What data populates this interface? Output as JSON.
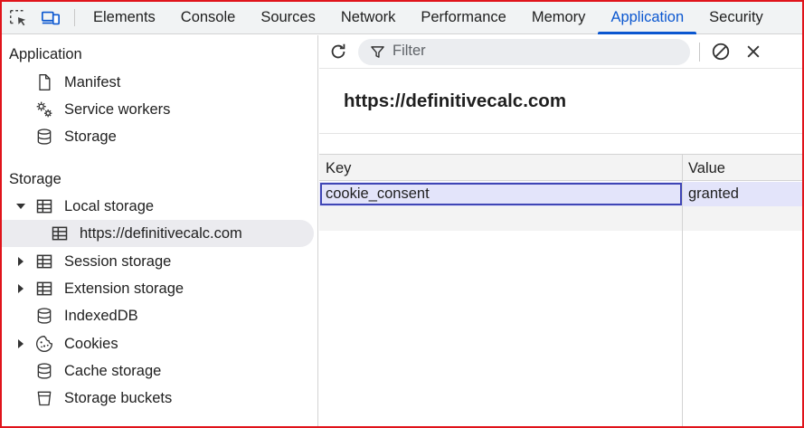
{
  "tabs": [
    {
      "label": "Elements"
    },
    {
      "label": "Console"
    },
    {
      "label": "Sources"
    },
    {
      "label": "Network"
    },
    {
      "label": "Performance"
    },
    {
      "label": "Memory"
    },
    {
      "label": "Application",
      "active": true
    },
    {
      "label": "Security"
    }
  ],
  "sidebar": {
    "application_title": "Application",
    "application_items": [
      {
        "label": "Manifest",
        "icon": "file-icon"
      },
      {
        "label": "Service workers",
        "icon": "gears-icon"
      },
      {
        "label": "Storage",
        "icon": "database-icon"
      }
    ],
    "storage_title": "Storage",
    "storage_items": [
      {
        "label": "Local storage",
        "icon": "table-icon",
        "arrow": "expanded"
      },
      {
        "label": "https://definitivecalc.com",
        "icon": "table-icon",
        "selected": true
      },
      {
        "label": "Session storage",
        "icon": "table-icon",
        "arrow": "collapsed"
      },
      {
        "label": "Extension storage",
        "icon": "table-icon",
        "arrow": "collapsed"
      },
      {
        "label": "IndexedDB",
        "icon": "database-icon"
      },
      {
        "label": "Cookies",
        "icon": "cookie-icon",
        "arrow": "collapsed"
      },
      {
        "label": "Cache storage",
        "icon": "database-icon"
      },
      {
        "label": "Storage buckets",
        "icon": "bucket-icon"
      }
    ]
  },
  "main": {
    "filter_placeholder": "Filter",
    "origin": "https://definitivecalc.com",
    "columns": {
      "key": "Key",
      "value": "Value"
    },
    "rows": [
      {
        "key": "cookie_consent",
        "value": "granted"
      }
    ]
  },
  "colors": {
    "accent": "#0b57d0",
    "selected_row": "#e3e4fa",
    "frame": "#e0141b"
  }
}
